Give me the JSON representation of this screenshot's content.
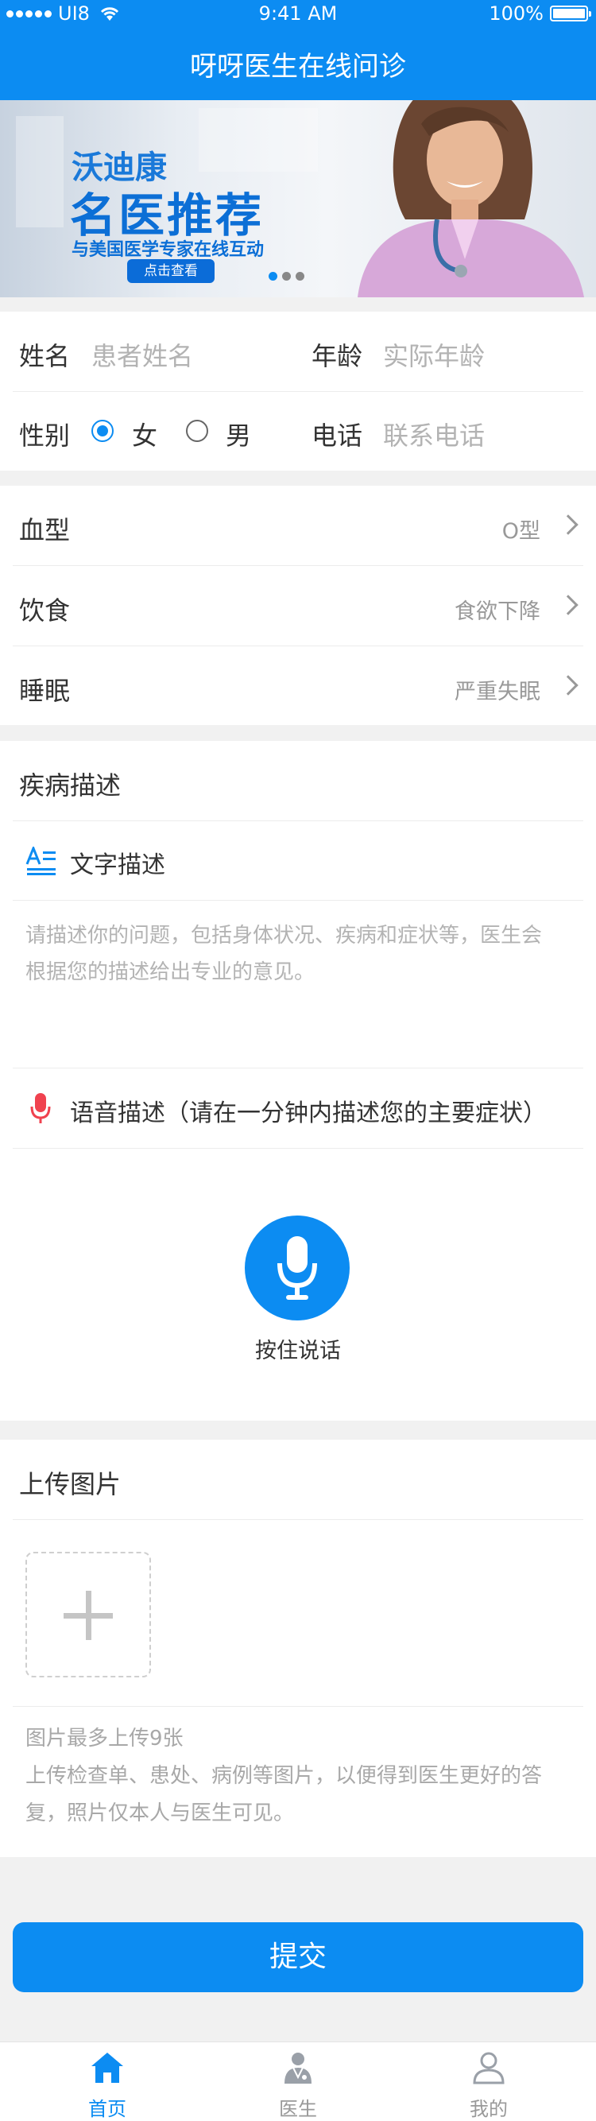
{
  "status_bar": {
    "carrier": "UI8",
    "time": "9:41 AM",
    "battery": "100%"
  },
  "header": {
    "title": "呀呀医生在线问诊"
  },
  "banner": {
    "title": "沃迪康",
    "headline": "名医推荐",
    "subtitle": "与美国医学专家在线互动",
    "button": "点击查看",
    "pages": 3,
    "active_page": 1
  },
  "patient_form": {
    "name_label": "姓名",
    "name_placeholder": "患者姓名",
    "age_label": "年龄",
    "age_placeholder": "实际年龄",
    "gender_label": "性别",
    "female": "女",
    "male": "男",
    "selected_gender": "女",
    "phone_label": "电话",
    "phone_placeholder": "联系电话"
  },
  "health_info": [
    {
      "label": "血型",
      "value": "O型"
    },
    {
      "label": "饮食",
      "value": "食欲下降"
    },
    {
      "label": "睡眠",
      "value": "严重失眠"
    }
  ],
  "disease": {
    "section_title": "疾病描述",
    "text_title": "文字描述",
    "text_placeholder_line1": "请描述你的问题，包括身体状况、疾病和症状等，医生会",
    "text_placeholder_line2": "根据您的描述给出专业的意见。",
    "voice_title": "语音描述（请在一分钟内描述您的主要症状）",
    "voice_button": "按住说话"
  },
  "upload": {
    "section_title": "上传图片",
    "hint_limit": "图片最多上传9张",
    "hint_line1": "上传检查单、患处、病例等图片，以便得到医生更好的答",
    "hint_line2": "复，照片仅本人与医生可见。"
  },
  "submit_label": "提交",
  "tabs": [
    {
      "label": "首页",
      "icon": "home-icon",
      "active": true
    },
    {
      "label": "医生",
      "icon": "doctor-icon",
      "active": false
    },
    {
      "label": "我的",
      "icon": "profile-icon",
      "active": false
    }
  ],
  "colors": {
    "accent": "#0c8cf2",
    "mic_red": "#f0424f"
  }
}
